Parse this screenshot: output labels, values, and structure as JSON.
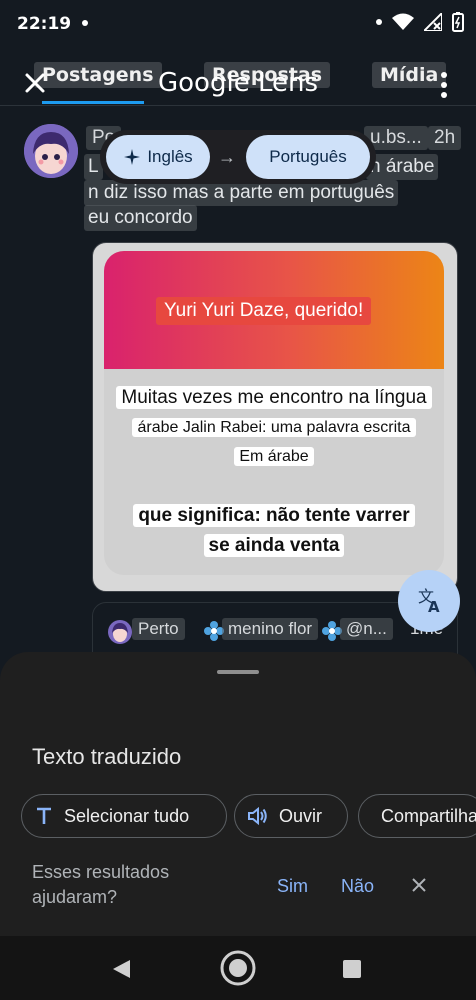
{
  "status": {
    "time": "22:19"
  },
  "header": {
    "title": "Google Lens",
    "bg_tabs": [
      "Postagens",
      "Respostas",
      "Mídia"
    ]
  },
  "post": {
    "name": "Po",
    "handle": "u.bs...",
    "time": "2h",
    "line1_start": "L",
    "line1_end": "n árabe",
    "line2": "n diz isso mas a parte em português",
    "line3": "eu concordo"
  },
  "language_bar": {
    "source": "Inglês",
    "target": "Português"
  },
  "image_text": {
    "title": "Yuri Yuri Daze, querido!",
    "line1": "Muitas vezes me encontro na língua",
    "line2": "árabe Jalin Rabei: uma palavra escrita",
    "line3": "Em árabe",
    "line4": "que significa: não tente varrer",
    "line5": "se ainda venta"
  },
  "reply": {
    "name": "Perto",
    "name2": "menino flor",
    "handle": "@n...",
    "time": "1me"
  },
  "sheet": {
    "title": "Texto traduzido",
    "select_all": "Selecionar tudo",
    "listen": "Ouvir",
    "share": "Compartilhar",
    "feedback_question": "Esses resultados ajudaram?",
    "yes": "Sim",
    "no": "Não"
  },
  "colors": {
    "accent_blue": "#8ab4f8",
    "pill_bg": "#cfe1f9",
    "tab_underline": "#1d9bf0"
  }
}
